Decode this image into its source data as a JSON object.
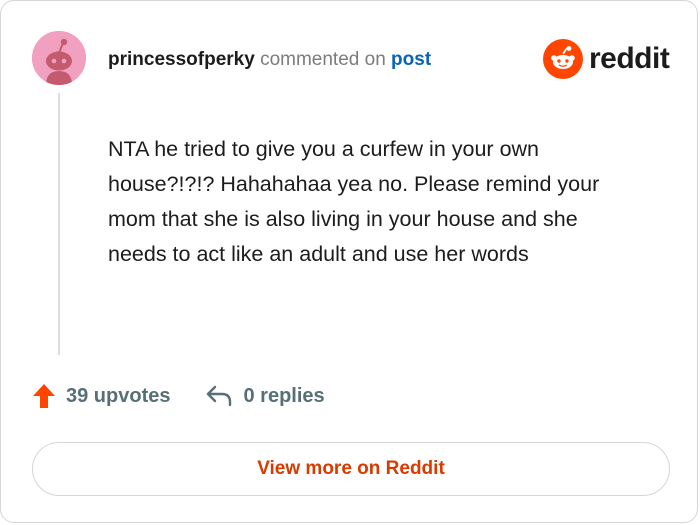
{
  "comment": {
    "username": "princessofperky",
    "action_text": "commented on",
    "post_link_text": "post",
    "body": "NTA he tried to give you a curfew in your own house?!?!? Hahahahaa yea no. Please remind your mom that she is also living in your house and she needs to act like an adult and use her words"
  },
  "brand": {
    "name": "reddit",
    "icon": "reddit-snoo-icon",
    "color": "#ff4500"
  },
  "stats": {
    "upvotes_label": "39 upvotes",
    "upvote_icon": "upvote-arrow-icon",
    "upvote_color": "#ff4500",
    "replies_label": "0 replies",
    "reply_icon": "reply-arrow-icon"
  },
  "cta": {
    "label": "View more on Reddit",
    "color": "#d93a00"
  },
  "avatar": {
    "icon": "snoo-avatar-icon",
    "background": "#f2a0c0"
  }
}
